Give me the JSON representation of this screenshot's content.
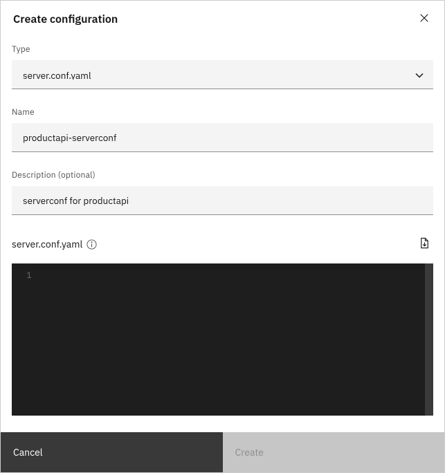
{
  "header": {
    "title": "Create configuration"
  },
  "form": {
    "type": {
      "label": "Type",
      "value": "server.conf.yaml"
    },
    "name": {
      "label": "Name",
      "value": "productapi-serverconf"
    },
    "description": {
      "label": "Description (optional)",
      "value": "serverconf for productapi"
    }
  },
  "editor": {
    "title": "server.conf.yaml",
    "line_number": "1",
    "content": ""
  },
  "footer": {
    "cancel": "Cancel",
    "create": "Create"
  }
}
